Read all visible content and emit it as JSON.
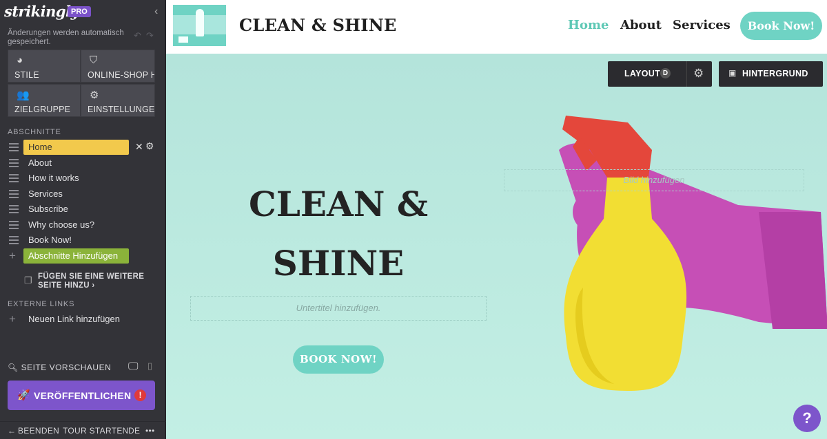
{
  "sidebar": {
    "logo": "strikingly",
    "badge": "PRO",
    "autosave": "Änderungen werden automatisch gespeichert.",
    "tiles": [
      {
        "label": "STILE",
        "icon": "palette-icon"
      },
      {
        "label": "ONLINE-SHOP H",
        "icon": "shop-icon"
      },
      {
        "label": "ZIELGRUPPE",
        "icon": "users-icon"
      },
      {
        "label": "EINSTELLUNGEN",
        "icon": "gear-icon"
      }
    ],
    "sections_heading": "ABSCHNITTE",
    "sections": [
      "Home",
      "About",
      "How it works",
      "Services",
      "Subscribe",
      "Why choose us?",
      "Book Now!"
    ],
    "add_section": "Abschnitte Hinzufügen",
    "add_page": "FÜGEN SIE EINE WEITERE SEITE HINZU ›",
    "external_heading": "EXTERNE LINKS",
    "add_link": "Neuen Link hinzufügen",
    "preview": "SEITE VORSCHAUEN",
    "publish": "VERÖFFENTLICHEN",
    "footer": {
      "exit": "BEENDEN",
      "tour": "TOUR STARTEN",
      "lang": "DE",
      "more": "•••"
    }
  },
  "nav": {
    "brand": "CLEAN & SHINE",
    "links": [
      "Home",
      "About",
      "Services"
    ],
    "active_link": "Home",
    "cta": "Book Now!"
  },
  "hero": {
    "title_line1": "CLEAN &",
    "title_line2": "SHINE",
    "subtitle_placeholder": "Untertitel hinzufügen.",
    "cta": "BOOK NOW!",
    "image_placeholder": "Bild hinzufügen",
    "layout_label": "LAYOUT",
    "layout_badge": "D",
    "background_label": "HINTERGRUND",
    "help": "?"
  },
  "colors": {
    "accent": "#6fd3c4",
    "purple": "#7d55cb",
    "sidebar": "#333338",
    "highlight": "#f2c94c",
    "green": "#8bb33a"
  }
}
